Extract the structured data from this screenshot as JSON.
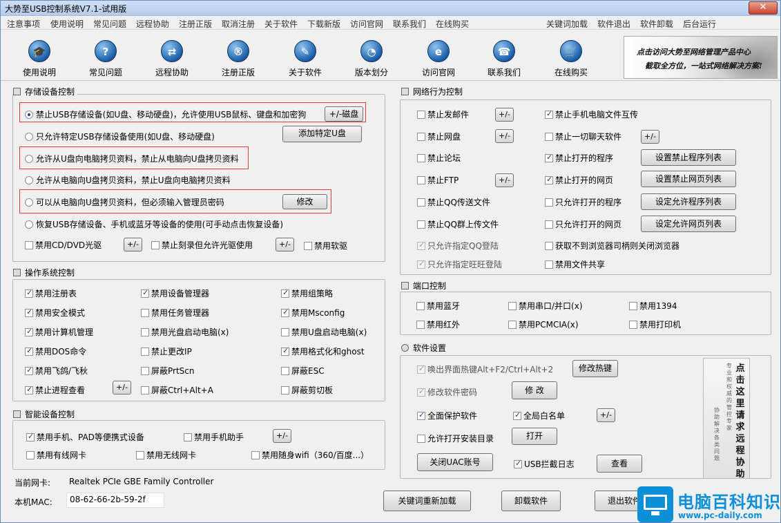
{
  "window": {
    "title": "大势至USB控制系统V7.1-试用版",
    "close_glyph": "✕"
  },
  "menu": {
    "left": [
      "注意事项",
      "使用说明",
      "常见问题",
      "远程协助",
      "注册正版",
      "取消注册",
      "关于软件",
      "下载新版",
      "访问官网",
      "联系我们",
      "在线购买"
    ],
    "right": [
      "关键词加载",
      "软件退出",
      "软件卸载",
      "后台运行"
    ]
  },
  "toolbar": {
    "buttons": [
      {
        "label": "使用说明",
        "icon": "graduation-cap-icon",
        "glyph": "🎓"
      },
      {
        "label": "常见问题",
        "icon": "question-icon",
        "glyph": "?"
      },
      {
        "label": "远程协助",
        "icon": "globe-remote-icon",
        "glyph": "⇄"
      },
      {
        "label": "注册正版",
        "icon": "registered-icon",
        "glyph": "®"
      },
      {
        "label": "关于软件",
        "icon": "notepad-icon",
        "glyph": "✎"
      },
      {
        "label": "版本划分",
        "icon": "pie-chart-icon",
        "glyph": "◔"
      },
      {
        "label": "访问官网",
        "icon": "ie-browser-icon",
        "glyph": "e"
      },
      {
        "label": "联系我们",
        "icon": "telephone-icon",
        "glyph": "☎"
      },
      {
        "label": "在线购买",
        "icon": "shopping-cart-icon",
        "glyph": "🛒"
      }
    ]
  },
  "banner": {
    "line1": "点击访问大势至网络管理产品中心",
    "line2": "截取全方位，一站式网络解决方案!"
  },
  "storage": {
    "title": "存储设备控制",
    "radios": [
      {
        "label": "禁止USB存储设备(如U盘、移动硬盘)，允许使用USB鼠标、键盘和加密狗",
        "checked": true
      },
      {
        "label": "只允许特定USB存储设备使用(如U盘、移动硬盘)",
        "checked": false
      },
      {
        "label": "允许从U盘向电脑拷贝资料，禁止从电脑向U盘拷贝资料",
        "checked": false
      },
      {
        "label": "允许从电脑向U盘拷贝资料，禁止U盘向电脑拷贝资料",
        "checked": false
      },
      {
        "label": "可以从电脑向U盘拷贝资料，但必须输入管理员密码",
        "checked": false
      },
      {
        "label": "恢复USB存储设备、手机或蓝牙等设备的使用(可手动点击恢复设备)",
        "checked": false
      }
    ],
    "buttons": {
      "disk": "+/-磁盘",
      "add_usb": "添加特定U盘",
      "modify": "修改",
      "pm": "+/-"
    },
    "checks": [
      {
        "label": "禁用CD/DVD光驱",
        "checked": false
      },
      {
        "label": "禁止刻录但允许光驱使用",
        "checked": false
      },
      {
        "label": "禁用软驱",
        "checked": false
      }
    ]
  },
  "os": {
    "title": "操作系统控制",
    "items": [
      {
        "label": "禁用注册表",
        "checked": true
      },
      {
        "label": "禁用设备管理器",
        "checked": true
      },
      {
        "label": "禁用组策略",
        "checked": true
      },
      {
        "label": "禁用安全模式",
        "checked": true
      },
      {
        "label": "禁用任务管理器",
        "checked": false
      },
      {
        "label": "禁用Msconfig",
        "checked": true
      },
      {
        "label": "禁用计算机管理",
        "checked": true
      },
      {
        "label": "禁用光盘启动电脑(x)",
        "checked": false
      },
      {
        "label": "禁用U盘启动电脑(x)",
        "checked": false
      },
      {
        "label": "禁用DOS命令",
        "checked": true
      },
      {
        "label": "禁止更改IP",
        "checked": false
      },
      {
        "label": "禁用格式化和ghost",
        "checked": true
      },
      {
        "label": "禁用飞鸽/飞秋",
        "checked": true
      },
      {
        "label": "屏蔽PrtScn",
        "checked": false
      },
      {
        "label": "屏蔽ESC",
        "checked": false
      },
      {
        "label": "禁止进程查看",
        "checked": true
      },
      {
        "label": "屏蔽Ctrl+Alt+A",
        "checked": false
      },
      {
        "label": "屏蔽剪切板",
        "checked": false
      }
    ],
    "pm": "+/-"
  },
  "smart": {
    "title": "智能设备控制",
    "items": [
      {
        "label": "禁用手机、PAD等便携式设备",
        "checked": true
      },
      {
        "label": "禁用手机助手",
        "checked": false
      },
      {
        "label": "禁用有线网卡",
        "checked": false
      },
      {
        "label": "禁用无线网卡",
        "checked": false
      },
      {
        "label": "禁用随身wifi（360/百度...）",
        "checked": false
      }
    ],
    "pm": "+/-"
  },
  "netinfo": {
    "nic_label": "当前网卡:",
    "nic_value": "Realtek PCIe GBE Family Controller",
    "mac_label": "本机MAC:",
    "mac_value": "08-62-66-2b-59-2f"
  },
  "network": {
    "title": "网络行为控制",
    "left": [
      {
        "label": "禁止发邮件",
        "checked": false,
        "disabled": false
      },
      {
        "label": "禁止网盘",
        "checked": false,
        "disabled": false
      },
      {
        "label": "禁止论坛",
        "checked": false,
        "disabled": false
      },
      {
        "label": "禁止FTP",
        "checked": false,
        "disabled": false
      },
      {
        "label": "禁止QQ传送文件",
        "checked": false,
        "disabled": false
      },
      {
        "label": "禁止QQ群上传文件",
        "checked": false,
        "disabled": false
      },
      {
        "label": "只允许指定QQ登陆",
        "checked": true,
        "disabled": true
      },
      {
        "label": "只允许指定旺旺登陆",
        "checked": true,
        "disabled": true
      }
    ],
    "right": [
      {
        "label": "禁止手机电脑文件互传",
        "checked": true
      },
      {
        "label": "禁止一切聊天软件",
        "checked": false
      },
      {
        "label": "禁止打开的程序",
        "checked": true
      },
      {
        "label": "禁止打开的网页",
        "checked": true
      },
      {
        "label": "只允许打开的程序",
        "checked": false
      },
      {
        "label": "只允许打开的网页",
        "checked": false
      },
      {
        "label": "获取不到浏览器司柄则关闭浏览器",
        "checked": false
      },
      {
        "label": "禁用文件共享",
        "checked": false
      }
    ],
    "buttons": {
      "pm": "+/-",
      "set_prog_block": "设置禁止程序列表",
      "set_web_block": "设置禁止网页列表",
      "set_prog_allow": "设定允许程序列表",
      "set_web_allow": "设定允许网页列表"
    }
  },
  "ports": {
    "title": "端口控制",
    "items": [
      {
        "label": "禁用蓝牙",
        "checked": false
      },
      {
        "label": "禁用串口/并口(x)",
        "checked": false
      },
      {
        "label": "禁用1394",
        "checked": false
      },
      {
        "label": "禁用红外",
        "checked": false
      },
      {
        "label": "禁用PCMCIA(x)",
        "checked": false
      },
      {
        "label": "禁用打印机",
        "checked": false
      }
    ]
  },
  "software": {
    "title": "软件设置",
    "hotkey": {
      "label": "唤出界面热键Alt+F2/Ctrl+Alt+2",
      "checked": true,
      "disabled": true
    },
    "password": {
      "label": "修改软件密码",
      "checked": true,
      "disabled": true
    },
    "protect": {
      "label": "全面保护软件",
      "checked": true
    },
    "whitelist": {
      "label": "全局白名单",
      "checked": true
    },
    "allow_install": {
      "label": "允许打开安装目录",
      "checked": false
    },
    "usb_log": {
      "label": "USB拦截日志",
      "checked": true
    },
    "buttons": {
      "hotkey": "修改热键",
      "password": "修 改",
      "pm": "+/-",
      "open": "打开",
      "uac": "关闭UAC账号",
      "view": "查看"
    },
    "calligraphy": {
      "col1": "点击这里请求远程协助",
      "col2": "专业和权威的管控专家",
      "col3": "协助解决各类问题"
    }
  },
  "bottom": {
    "reload": "关键词重新加载",
    "uninstall": "卸载软件",
    "exit": "退出软件"
  },
  "watermark": {
    "title": "电脑百科知识",
    "url": "www.pc-daily.com"
  }
}
